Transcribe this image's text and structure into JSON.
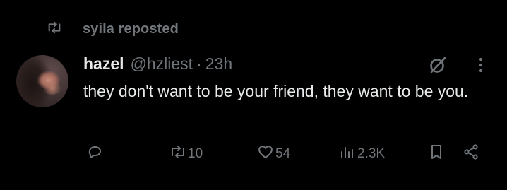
{
  "repost": {
    "label": "syila reposted"
  },
  "tweet": {
    "author_name": "hazel",
    "handle": "@hzliest",
    "separator": "·",
    "time": "23h",
    "text": "they don't want to be your friend, they want to be you."
  },
  "actions": {
    "retweet_count": "10",
    "like_count": "54",
    "views_count": "2.3K"
  },
  "icons": {
    "repost": "repost-icon",
    "grok": "grok-icon",
    "more": "more-icon",
    "reply": "reply-icon",
    "retweet": "retweet-icon",
    "like": "heart-icon",
    "views": "views-icon",
    "bookmark": "bookmark-icon",
    "share": "share-icon"
  },
  "colors": {
    "background": "#000000",
    "primary_text": "#e7e9ea",
    "secondary_text": "#71767b",
    "divider": "#2f3336"
  }
}
